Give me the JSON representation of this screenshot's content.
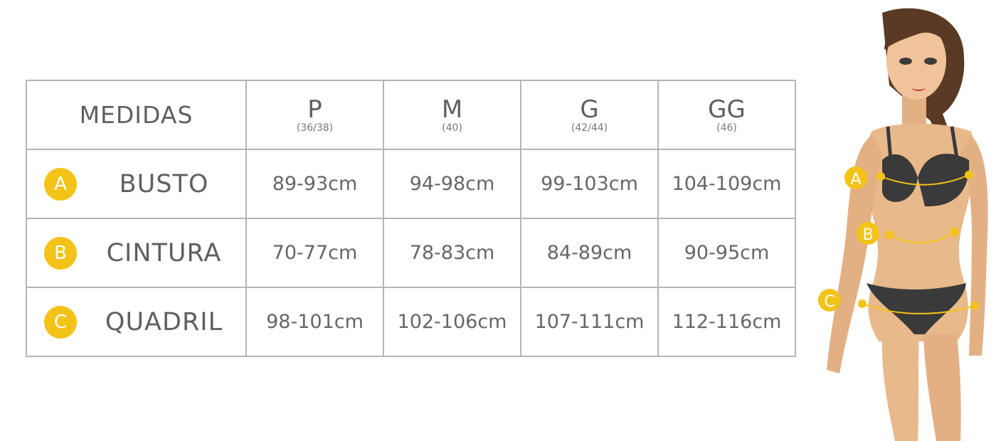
{
  "header": {
    "label_title": "MEDIDAS",
    "sizes": [
      {
        "letter": "P",
        "numbers": "(36/38)"
      },
      {
        "letter": "M",
        "numbers": "(40)"
      },
      {
        "letter": "G",
        "numbers": "(42/44)"
      },
      {
        "letter": "GG",
        "numbers": "(46)"
      }
    ]
  },
  "rows": [
    {
      "badge": "A",
      "name": "BUSTO",
      "values": [
        "89-93cm",
        "94-98cm",
        "99-103cm",
        "104-109cm"
      ]
    },
    {
      "badge": "B",
      "name": "CINTURA",
      "values": [
        "70-77cm",
        "78-83cm",
        "84-89cm",
        "90-95cm"
      ]
    },
    {
      "badge": "C",
      "name": "QUADRIL",
      "values": [
        "98-101cm",
        "102-106cm",
        "107-111cm",
        "112-116cm"
      ]
    }
  ],
  "figure": {
    "markers": [
      "A",
      "B",
      "C"
    ]
  },
  "colors": {
    "badge": "#f3c318",
    "border": "#b5b5b5",
    "text": "#666666",
    "bikini": "#3a3a3a",
    "skin": "#e8b98a"
  },
  "chart_data": {
    "type": "table",
    "columns": [
      "MEDIDAS",
      "P (36/38)",
      "M (40)",
      "G (42/44)",
      "GG (46)"
    ],
    "rows": [
      [
        "BUSTO",
        "89-93cm",
        "94-98cm",
        "99-103cm",
        "104-109cm"
      ],
      [
        "CINTURA",
        "70-77cm",
        "78-83cm",
        "84-89cm",
        "90-95cm"
      ],
      [
        "QUADRIL",
        "98-101cm",
        "102-106cm",
        "107-111cm",
        "112-116cm"
      ]
    ]
  }
}
